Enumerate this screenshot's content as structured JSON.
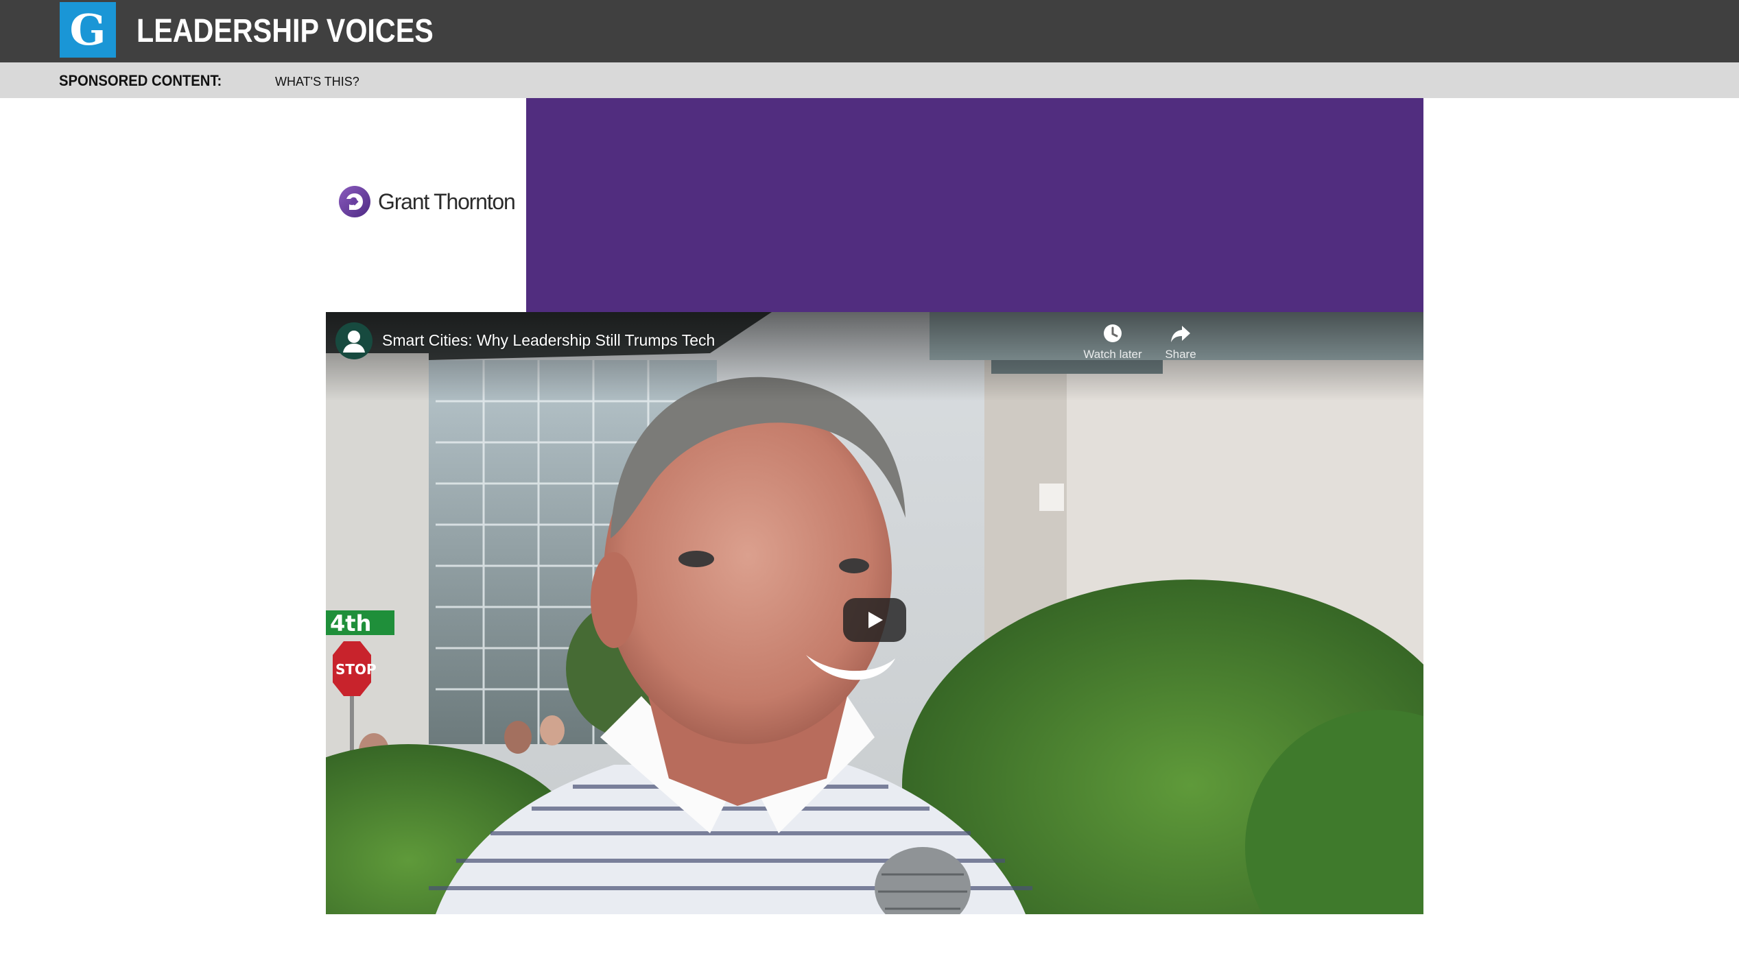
{
  "header": {
    "logo_letter": "G",
    "title": "LEADERSHIP VOICES",
    "logo_color": "#1a96d6",
    "bar_color": "#404040"
  },
  "subbar": {
    "sponsored_label": "SPONSORED CONTENT:",
    "whats_this_link": "WHAT'S THIS?",
    "bar_color": "#d9d9d9"
  },
  "sponsor": {
    "name": "Grant Thornton",
    "logo_icon": "grant-thornton-logo",
    "banner_color": "#512d7f"
  },
  "video": {
    "title": "Smart Cities: Why Leadership Still Trumps Tech",
    "watch_later_label": "Watch later",
    "share_label": "Share",
    "watch_later_icon": "clock-icon",
    "share_icon": "share-arrow-icon",
    "play_icon": "play-icon",
    "channel_icon": "channel-avatar-icon",
    "street_sign_text": "4th",
    "stop_sign_text": "STOP"
  }
}
